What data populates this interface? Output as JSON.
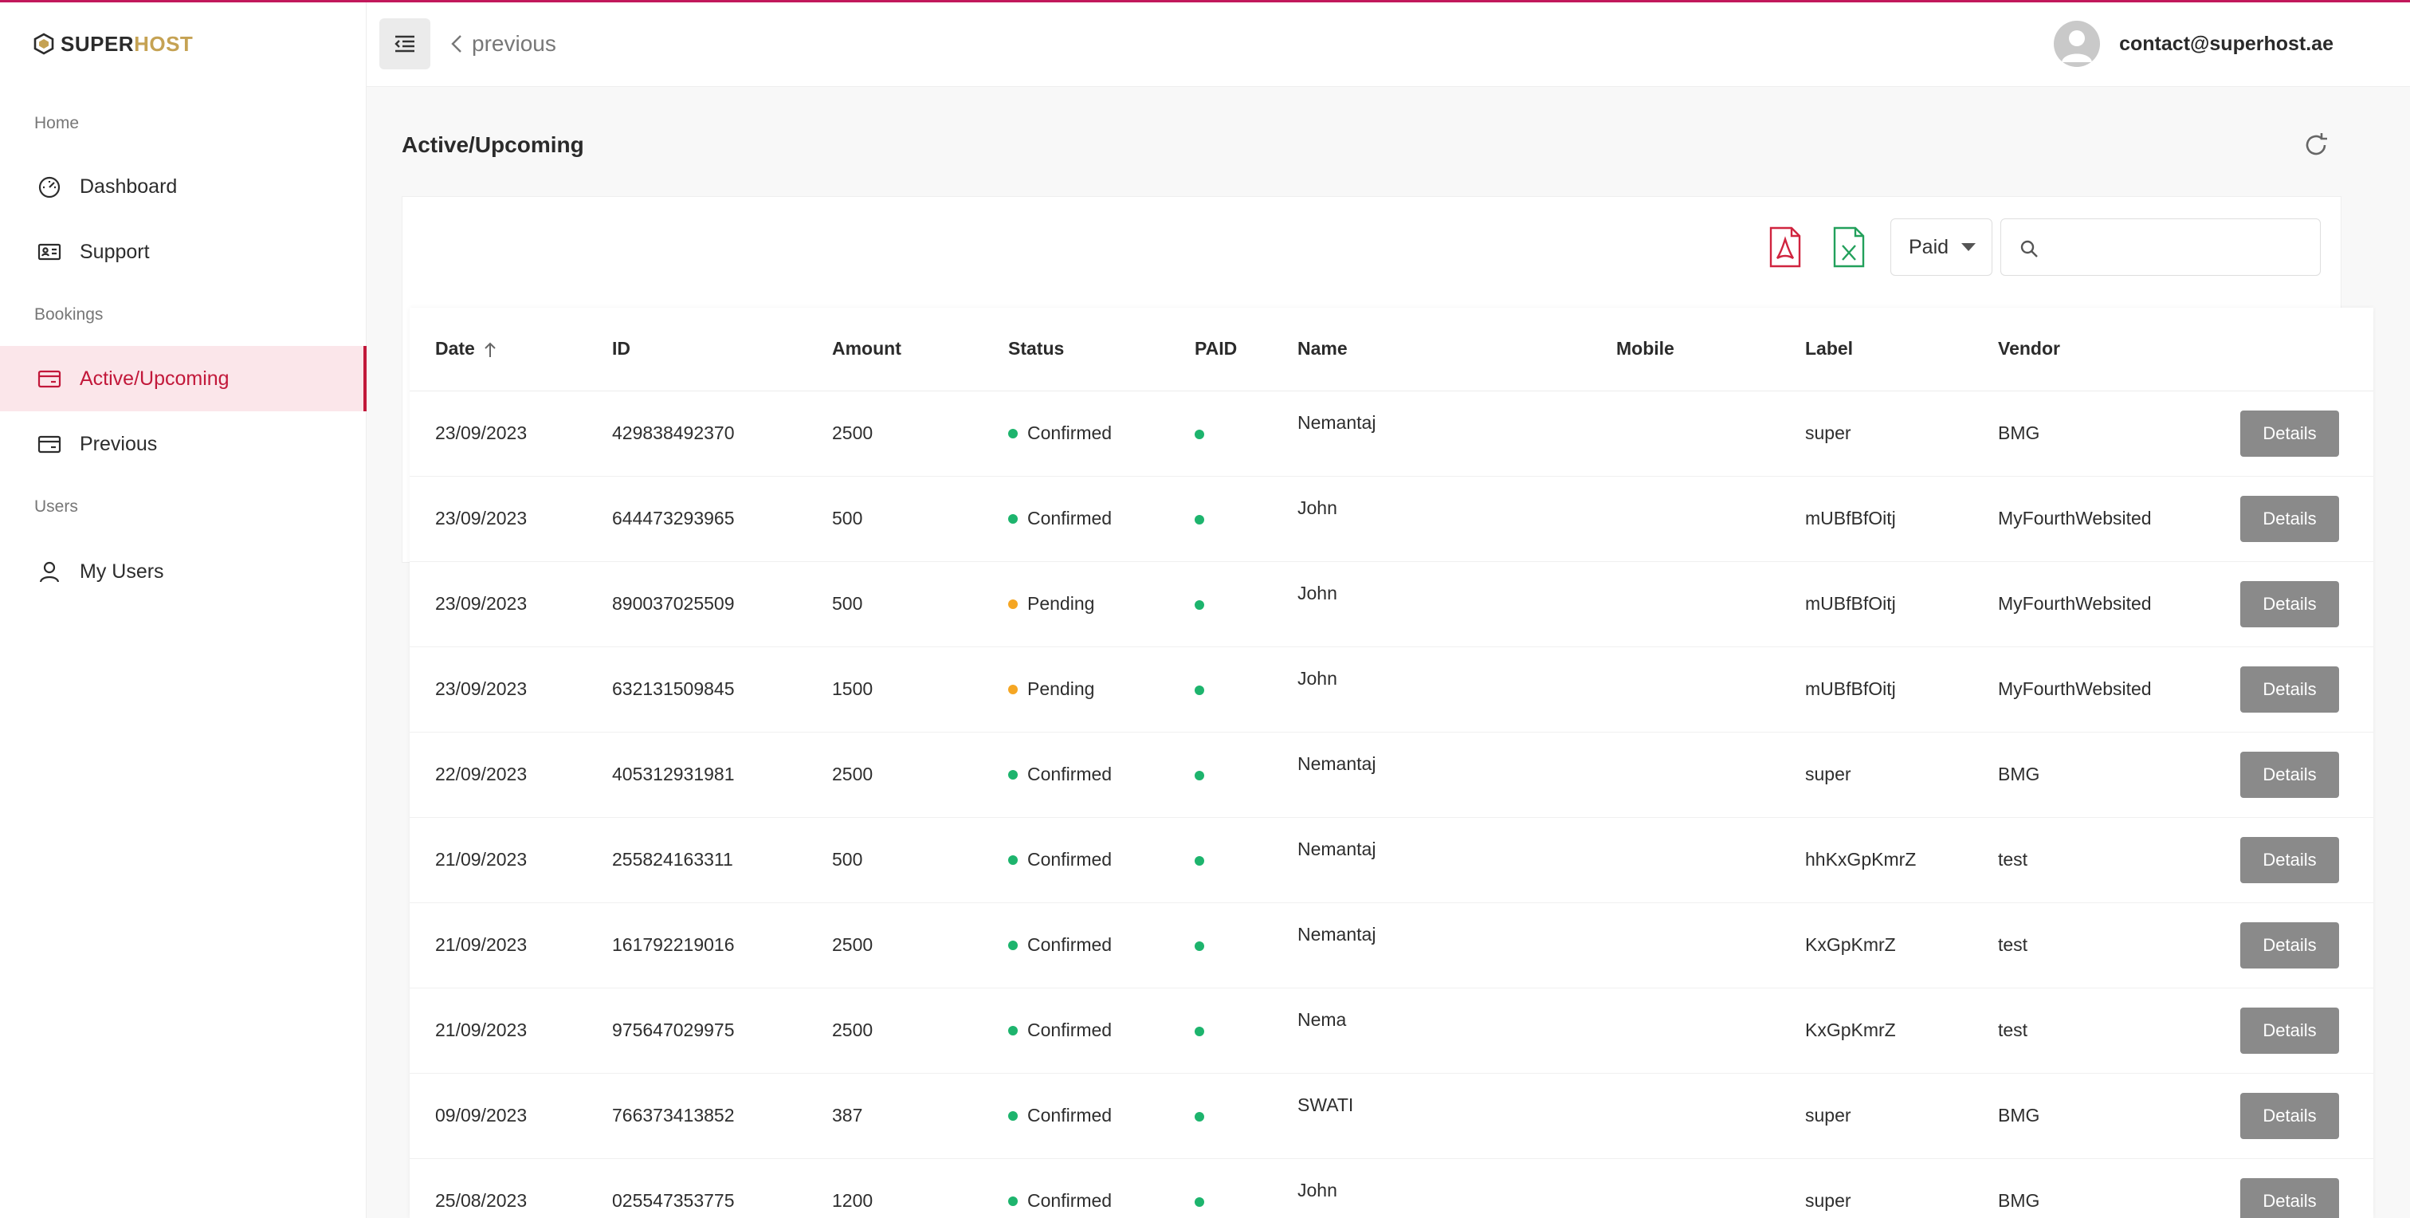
{
  "brand": {
    "part1": "SUPER",
    "part2": "HOST"
  },
  "sidebar": {
    "sections": [
      {
        "label": "Home",
        "items": [
          {
            "label": "Dashboard",
            "icon": "gauge-icon"
          },
          {
            "label": "Support",
            "icon": "id-card-icon"
          }
        ]
      },
      {
        "label": "Bookings",
        "items": [
          {
            "label": "Active/Upcoming",
            "icon": "card-icon",
            "active": true
          },
          {
            "label": "Previous",
            "icon": "card-icon"
          }
        ]
      },
      {
        "label": "Users",
        "items": [
          {
            "label": "My Users",
            "icon": "user-icon"
          }
        ]
      }
    ]
  },
  "header": {
    "back_label": "previous",
    "user_email": "contact@superhost.ae"
  },
  "main": {
    "title": "Active/Upcoming",
    "filter": {
      "selected": "Paid"
    },
    "search": {
      "placeholder": ""
    }
  },
  "colors": {
    "accent": "#c2183a",
    "confirmed": "#1db46d",
    "pending": "#f5a623",
    "paid": "#1db46d"
  },
  "table": {
    "columns": [
      "Date",
      "ID",
      "Amount",
      "Status",
      "PAID",
      "Name",
      "Mobile",
      "Label",
      "Vendor"
    ],
    "details_label": "Details",
    "rows": [
      {
        "date": "23/09/2023",
        "id": "429838492370",
        "amount": "2500",
        "status": "Confirmed",
        "name": "Nemantaj",
        "mobile": "",
        "label": "super",
        "vendor": "BMG"
      },
      {
        "date": "23/09/2023",
        "id": "644473293965",
        "amount": "500",
        "status": "Confirmed",
        "name": "John",
        "mobile": "",
        "label": "mUBfBfOitj",
        "vendor": "MyFourthWebsited"
      },
      {
        "date": "23/09/2023",
        "id": "890037025509",
        "amount": "500",
        "status": "Pending",
        "name": "John",
        "mobile": "",
        "label": "mUBfBfOitj",
        "vendor": "MyFourthWebsited"
      },
      {
        "date": "23/09/2023",
        "id": "632131509845",
        "amount": "1500",
        "status": "Pending",
        "name": "John",
        "mobile": "",
        "label": "mUBfBfOitj",
        "vendor": "MyFourthWebsited"
      },
      {
        "date": "22/09/2023",
        "id": "405312931981",
        "amount": "2500",
        "status": "Confirmed",
        "name": "Nemantaj",
        "mobile": "",
        "label": "super",
        "vendor": "BMG"
      },
      {
        "date": "21/09/2023",
        "id": "255824163311",
        "amount": "500",
        "status": "Confirmed",
        "name": "Nemantaj",
        "mobile": "",
        "label": "hhKxGpKmrZ",
        "vendor": "test"
      },
      {
        "date": "21/09/2023",
        "id": "161792219016",
        "amount": "2500",
        "status": "Confirmed",
        "name": "Nemantaj",
        "mobile": "",
        "label": "KxGpKmrZ",
        "vendor": "test"
      },
      {
        "date": "21/09/2023",
        "id": "975647029975",
        "amount": "2500",
        "status": "Confirmed",
        "name": "Nema",
        "mobile": "",
        "label": "KxGpKmrZ",
        "vendor": "test"
      },
      {
        "date": "09/09/2023",
        "id": "766373413852",
        "amount": "387",
        "status": "Confirmed",
        "name": "SWATI",
        "mobile": "",
        "label": "super",
        "vendor": "BMG"
      },
      {
        "date": "25/08/2023",
        "id": "025547353775",
        "amount": "1200",
        "status": "Confirmed",
        "name": "John",
        "mobile": "",
        "label": "super",
        "vendor": "BMG"
      }
    ]
  }
}
